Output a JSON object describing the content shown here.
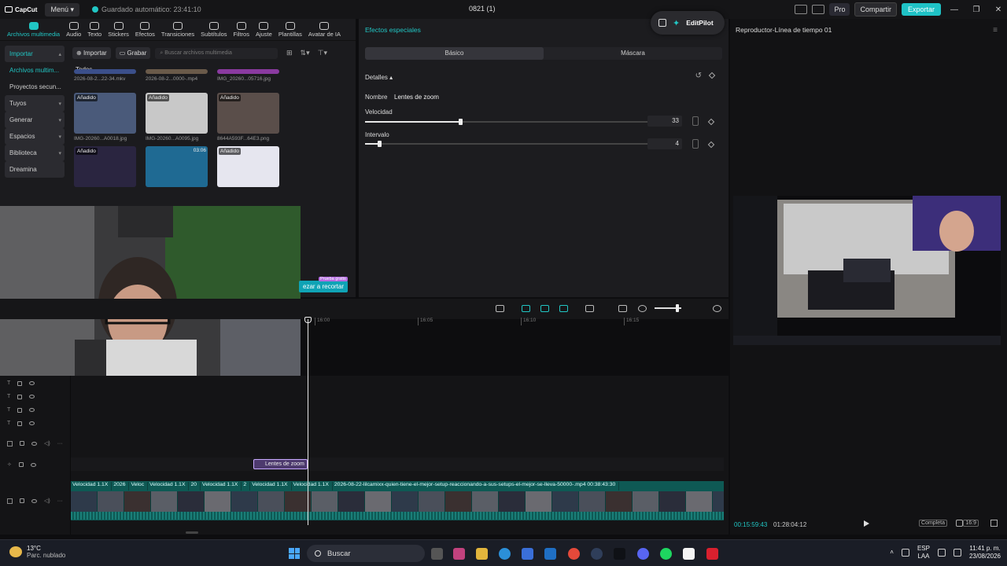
{
  "titlebar": {
    "logo": "CapCut",
    "menu_label": "Menú",
    "autosave": "Guardado automático: 23:41:10",
    "project_title": "0821 (1)",
    "pro_label": "Pro",
    "share_label": "Compartir",
    "export_label": "Exportar"
  },
  "tool_tabs": [
    {
      "label": "Archivos multimedia",
      "icon": "media-icon",
      "active": true
    },
    {
      "label": "Audio",
      "icon": "audio-icon"
    },
    {
      "label": "Texto",
      "icon": "text-icon"
    },
    {
      "label": "Stickers",
      "icon": "sticker-icon"
    },
    {
      "label": "Efectos",
      "icon": "effects-icon"
    },
    {
      "label": "Transiciones",
      "icon": "transitions-icon"
    },
    {
      "label": "Subtítulos",
      "icon": "subtitles-icon"
    },
    {
      "label": "Filtros",
      "icon": "filters-icon"
    },
    {
      "label": "Ajuste",
      "icon": "adjust-icon"
    },
    {
      "label": "Plantillas",
      "icon": "templates-icon"
    },
    {
      "label": "Avatar de IA",
      "icon": "avatar-icon"
    }
  ],
  "side_nav": [
    {
      "label": "Importar",
      "chev": "▴",
      "active": true,
      "hl": true
    },
    {
      "label": "Archivos multim...",
      "active": true
    },
    {
      "label": "Proyectos secun..."
    },
    {
      "label": "Tuyos",
      "chev": "▾",
      "hl": true
    },
    {
      "label": "Generar",
      "chev": "▾",
      "hl": true
    },
    {
      "label": "Espacios",
      "chev": "▾",
      "hl": true
    },
    {
      "label": "Biblioteca",
      "chev": "▾",
      "hl": true
    },
    {
      "label": "Dreamina",
      "hl": true
    }
  ],
  "media": {
    "import_label": "Importar",
    "record_label": "Grabar",
    "search_placeholder": "Buscar archivos multimedia",
    "all_label": "Todos",
    "row0": [
      "2026-08-2...22-34.mkv",
      "2026-08-2...0000-.mp4",
      "IMG_20260...05716.jpg"
    ],
    "row1": [
      {
        "badge": "Añadido",
        "caption": "IMG-20260...A0018.jpg",
        "color": "#4a5a7a"
      },
      {
        "badge": "Añadido",
        "caption": "IMG-20260...A0095.jpg",
        "color": "#c8c8c8"
      },
      {
        "badge": "Añadido",
        "caption": "8644A593F...64E3.png",
        "color": "#5a4e4a"
      }
    ],
    "row2": [
      {
        "badge": "Añadido",
        "caption": "",
        "color": "#2a2540"
      },
      {
        "badge": "",
        "duration": "03:06",
        "caption": "",
        "color": "#1f6a93"
      },
      {
        "badge": "Añadido",
        "caption": "",
        "color": "#e6e6ef"
      }
    ]
  },
  "cut_button": "ezar a recortar",
  "free_tag": "Prueba gratis",
  "effects": {
    "title": "Efectos especiales",
    "tabs": [
      "Básico",
      "Máscara"
    ],
    "details_label": "Detalles ▴",
    "name_label": "Nombre",
    "name_value": "Lentes de zoom",
    "speed_label": "Velocidad",
    "speed_value": "33",
    "speed_level": 0.33,
    "interval_label": "Intervalo",
    "interval_value": "4",
    "interval_level": 0.05
  },
  "editpilot": {
    "label": "EditPilot"
  },
  "player": {
    "title": "Reproductor-Línea de tiempo 01",
    "current_time": "00:15:59:43",
    "total_time": "01:28:04:12",
    "full_label": "Completa",
    "ratio_label": "16:9"
  },
  "timeline": {
    "ticks": [
      "16:00",
      "16:05",
      "16:10",
      "16:15"
    ],
    "fx_clip_label": "Lentes de zoom",
    "clip_labels": [
      "Velocidad 1.1X",
      "2026",
      "Veloc",
      "Velocidad 1.1X",
      "20",
      "Velocidad 1.1X",
      "2",
      "Velocidad 1.1X",
      "Velocidad 1.1X",
      "2026-08-22-lilcamixx-quien-tiene-el-mejor-setup-reaccionando-a-sus-setups-el-mejor-se-lleva-50000-.mp4   00:38:43:30"
    ]
  },
  "taskbar": {
    "temp": "13°C",
    "weather": "Parc. nublado",
    "search_label": "Buscar",
    "lang_top": "ESP",
    "lang_bottom": "LAA",
    "clock_time": "11:41 p. m.",
    "clock_date": "23/08/2026"
  }
}
